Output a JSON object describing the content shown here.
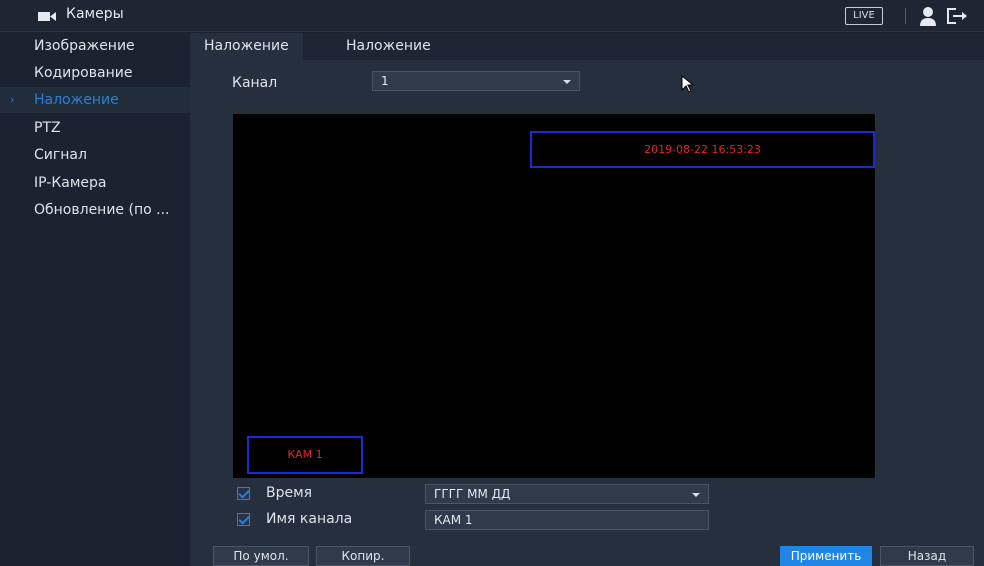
{
  "header": {
    "title": "Камеры",
    "live_label": "LIVE"
  },
  "sidebar": {
    "items": [
      {
        "label": "Изображение",
        "active": false
      },
      {
        "label": "Кодирование",
        "active": false
      },
      {
        "label": "Наложение",
        "active": true
      },
      {
        "label": "PTZ",
        "active": false
      },
      {
        "label": "Сигнал",
        "active": false
      },
      {
        "label": "IP-Камера",
        "active": false
      },
      {
        "label": "Обновление (по ...",
        "active": false
      }
    ]
  },
  "tabs": [
    {
      "label": "Наложение",
      "active": true
    },
    {
      "label": "Наложение",
      "active": false
    }
  ],
  "channel": {
    "label": "Канал",
    "value": "1"
  },
  "preview": {
    "time_text": "2019-08-22 16:53:23",
    "name_text": "КАМ 1"
  },
  "options": {
    "time": {
      "label": "Время",
      "checked": true,
      "format_value": "ГГГГ ММ ДД"
    },
    "channel_name": {
      "label": "Имя канала",
      "checked": true,
      "value": "КАМ 1"
    }
  },
  "buttons": {
    "default": "По умол.",
    "copy": "Копир.",
    "apply": "Применить",
    "back": "Назад"
  },
  "colors": {
    "accent": "#1f86e6",
    "overlay_border": "#1a2bd0",
    "overlay_text": "#e02828"
  }
}
